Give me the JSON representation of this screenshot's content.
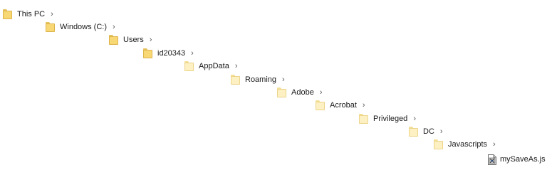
{
  "tree": {
    "items": [
      {
        "label": "This PC",
        "chevron": "›"
      },
      {
        "label": "Windows (C:)",
        "chevron": "›"
      },
      {
        "label": "Users",
        "chevron": "›"
      },
      {
        "label": "id20343",
        "chevron": "›"
      },
      {
        "label": "AppData",
        "chevron": "›"
      },
      {
        "label": "Roaming",
        "chevron": "›"
      },
      {
        "label": "Adobe",
        "chevron": "›"
      },
      {
        "label": "Acrobat",
        "chevron": "›"
      },
      {
        "label": "Privileged",
        "chevron": "›"
      },
      {
        "label": "DC",
        "chevron": "›"
      },
      {
        "label": "Javascripts",
        "chevron": "›"
      }
    ],
    "file": {
      "label": "mySaveAs.js"
    }
  },
  "icons": {
    "folder": "folder-icon",
    "file": "javascript-file-icon"
  },
  "colors": {
    "folder_fill": "#f8d775",
    "folder_pale_fill": "#fdf0c2",
    "folder_border": "#dcb44a"
  }
}
